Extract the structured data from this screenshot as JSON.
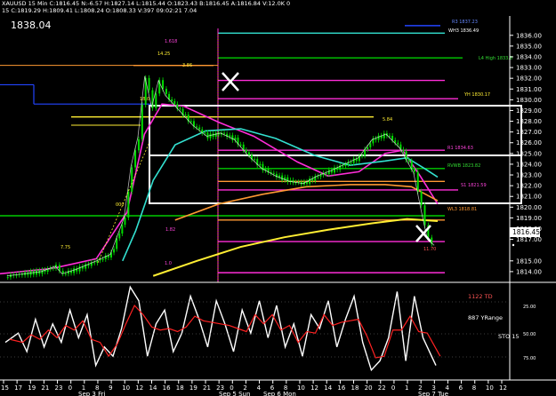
{
  "header": {
    "line1": "XAUUSD 15 Min C:1816.45 N:-6.57 H:1827.14 L:1815.44 O:1823.43 B:1816.45 A:1816.84 V:12.0K 0",
    "line2": "15 C:1819.29 H:1809.41 L:1808.24 O:1808.33 V:397 09:02:21 7.04"
  },
  "price_label": "1838.04",
  "current_price": "1816.45",
  "colors": {
    "background": "#000000",
    "candle": "#00dd00",
    "price_line": "#ffffff",
    "ma_magenta": "#ff2dd8",
    "ma_cyan": "#33e0d0",
    "ma_orange": "#ff9933",
    "ma_yellow": "#ffee33",
    "green_level": "#00cc00",
    "blue_level": "#2244ff",
    "td_red": "#ff2222",
    "stoch_white": "#ffffff",
    "box": "#ffffff"
  },
  "level_labels": {
    "r3": "R3 1837.23",
    "wh3": "WH3 1836.49",
    "l4high": "L4 High 1833.8",
    "yh": "YH 1830.17",
    "r1": "R1 1834.63",
    "mm": "MM 1826.53",
    "rvwb": "RVWB 1823.82",
    "s1": "S1 1821.59",
    "wl3": "WL3 1818.81",
    "m1": "1.618",
    "m2": "1.0",
    "m3": "1.82",
    "m4": "11.70",
    "k1425": "14.25",
    "k386": "3.86",
    "k584": "5.84",
    "k775": "7.75",
    "k18": "18.0",
    "k000": "000"
  },
  "price_ticks": [
    "1836.00",
    "1835.00",
    "1834.00",
    "1833.00",
    "1832.00",
    "1831.00",
    "1830.00",
    "1829.00",
    "1828.00",
    "1827.00",
    "1826.00",
    "1825.00",
    "1824.00",
    "1823.00",
    "1822.00",
    "1821.00",
    "1820.00",
    "1819.00",
    "1818.00",
    "1817.00",
    "1815.00",
    "1814.00"
  ],
  "time_ticks": [
    "15",
    "17",
    "19",
    "21",
    "23",
    "0",
    "1",
    "8",
    "9",
    "10",
    "12",
    "14",
    "16",
    "18",
    "19",
    "21",
    "23",
    "0",
    "2",
    "4",
    "6",
    "8",
    "10",
    "12",
    "14",
    "16",
    "18",
    "20",
    "22",
    "0",
    "1",
    "2",
    "3",
    "4",
    "6",
    "8",
    "10",
    "12"
  ],
  "date_labels": [
    "Sep 3 Fri",
    "Sep 5 Sun",
    "Sep 6 Mon",
    "Sep 7 Tue"
  ],
  "indicator": {
    "td_label": "1122 TD",
    "yrange_label": "887 YRange",
    "sto_label": "STO 15",
    "axis_ticks": [
      "25.00",
      "50.00",
      "75.00"
    ]
  },
  "chart_data": {
    "type": "candlestick",
    "instrument": "XAUUSD",
    "timeframe": "15 Min",
    "title": "",
    "xlabel": "",
    "ylabel": "",
    "ylim": [
      1813.0,
      1837.8
    ],
    "x_range": [
      "Sep 3 14:00",
      "Sep 7 03:00"
    ],
    "grid": false,
    "price_path": [
      [
        "Sep 3 15:00",
        1813.6
      ],
      [
        "Sep 3 20:00",
        1814.0
      ],
      [
        "Sep 3 22:00",
        1814.5
      ],
      [
        "Sep 3 23:00",
        1813.8
      ],
      [
        "Sep 5 23:00",
        1814.2
      ],
      [
        "Sep 6 02:00",
        1815.0
      ],
      [
        "Sep 6 04:00",
        1815.6
      ],
      [
        "Sep 6 06:00",
        1819.0
      ],
      [
        "Sep 6 07:00",
        1823.8
      ],
      [
        "Sep 6 08:00",
        1826.5
      ],
      [
        "Sep 6 09:00",
        1832.2
      ],
      [
        "Sep 6 10:00",
        1829.3
      ],
      [
        "Sep 6 11:00",
        1831.8
      ],
      [
        "Sep 6 12:00",
        1830.4
      ],
      [
        "Sep 6 14:00",
        1829.0
      ],
      [
        "Sep 6 16:00",
        1827.6
      ],
      [
        "Sep 6 18:00",
        1826.6
      ],
      [
        "Sep 6 20:00",
        1826.9
      ],
      [
        "Sep 6 22:00",
        1826.3
      ],
      [
        "Sep 7 00:00",
        1824.8
      ],
      [
        "Sep 7 02:00",
        1823.6
      ],
      [
        "Sep 7 04:00",
        1822.9
      ],
      [
        "Sep 7 06:00",
        1822.4
      ],
      [
        "Sep 7 08:00",
        1822.2
      ],
      [
        "Sep 7 10:00",
        1822.9
      ],
      [
        "Sep 7 12:00",
        1823.4
      ],
      [
        "Sep 7 14:00",
        1824.0
      ],
      [
        "Sep 7 16:00",
        1824.6
      ],
      [
        "Sep 7 18:00",
        1826.3
      ],
      [
        "Sep 7 20:00",
        1826.8
      ],
      [
        "Sep 7 22:00",
        1825.5
      ],
      [
        "Sep 8 00:00",
        1823.2
      ],
      [
        "Sep 8 01:00",
        1820.0
      ],
      [
        "Sep 8 02:00",
        1817.0
      ],
      [
        "Sep 8 03:00",
        1816.45
      ]
    ],
    "series": [
      {
        "name": "ma_magenta",
        "values": [
          [
            0.0,
            1813.8
          ],
          [
            0.12,
            1814.3
          ],
          [
            0.22,
            1815.2
          ],
          [
            0.29,
            1819.5
          ],
          [
            0.33,
            1826.8
          ],
          [
            0.37,
            1829.6
          ],
          [
            0.42,
            1829.4
          ],
          [
            0.5,
            1827.9
          ],
          [
            0.58,
            1826.6
          ],
          [
            0.68,
            1824.2
          ],
          [
            0.75,
            1822.9
          ],
          [
            0.82,
            1823.3
          ],
          [
            0.88,
            1825.0
          ],
          [
            0.92,
            1825.3
          ],
          [
            0.96,
            1822.9
          ],
          [
            1.0,
            1820.3
          ]
        ]
      },
      {
        "name": "ma_cyan",
        "values": [
          [
            0.28,
            1815.0
          ],
          [
            0.31,
            1817.8
          ],
          [
            0.35,
            1822.5
          ],
          [
            0.4,
            1825.8
          ],
          [
            0.47,
            1827.1
          ],
          [
            0.55,
            1827.3
          ],
          [
            0.63,
            1826.4
          ],
          [
            0.72,
            1824.8
          ],
          [
            0.8,
            1823.9
          ],
          [
            0.88,
            1824.3
          ],
          [
            0.93,
            1824.6
          ],
          [
            0.97,
            1823.6
          ],
          [
            1.0,
            1822.8
          ]
        ]
      },
      {
        "name": "ma_orange",
        "values": [
          [
            0.4,
            1818.8
          ],
          [
            0.5,
            1820.3
          ],
          [
            0.6,
            1821.2
          ],
          [
            0.7,
            1821.9
          ],
          [
            0.8,
            1822.1
          ],
          [
            0.88,
            1822.1
          ],
          [
            0.94,
            1821.9
          ],
          [
            1.0,
            1820.6
          ]
        ]
      },
      {
        "name": "ma_yellow",
        "values": [
          [
            0.35,
            1813.6
          ],
          [
            0.45,
            1815.0
          ],
          [
            0.55,
            1816.3
          ],
          [
            0.65,
            1817.2
          ],
          [
            0.75,
            1817.9
          ],
          [
            0.85,
            1818.5
          ],
          [
            0.93,
            1818.9
          ],
          [
            1.0,
            1818.7
          ]
        ]
      }
    ],
    "levels": [
      {
        "value": 1836.9,
        "color": "blue"
      },
      {
        "value": 1836.2,
        "color": "cyan"
      },
      {
        "value": 1833.9,
        "color": "green"
      },
      {
        "value": 1833.2,
        "color": "orange"
      },
      {
        "value": 1831.8,
        "color": "magenta"
      },
      {
        "value": 1830.1,
        "color": "magenta"
      },
      {
        "value": 1828.4,
        "color": "yellow"
      },
      {
        "value": 1825.3,
        "color": "magenta"
      },
      {
        "value": 1823.6,
        "color": "green"
      },
      {
        "value": 1822.4,
        "color": "orange"
      },
      {
        "value": 1821.6,
        "color": "magenta"
      },
      {
        "value": 1819.2,
        "color": "green"
      },
      {
        "value": 1818.8,
        "color": "orange"
      },
      {
        "value": 1816.8,
        "color": "magenta"
      },
      {
        "value": 1813.9,
        "color": "magenta"
      }
    ],
    "stochastic": [
      [
        0.0,
        0.35
      ],
      [
        0.03,
        0.45
      ],
      [
        0.05,
        0.25
      ],
      [
        0.07,
        0.6
      ],
      [
        0.09,
        0.3
      ],
      [
        0.11,
        0.55
      ],
      [
        0.13,
        0.35
      ],
      [
        0.15,
        0.7
      ],
      [
        0.17,
        0.4
      ],
      [
        0.19,
        0.65
      ],
      [
        0.21,
        0.1
      ],
      [
        0.23,
        0.3
      ],
      [
        0.25,
        0.2
      ],
      [
        0.27,
        0.5
      ],
      [
        0.29,
        0.95
      ],
      [
        0.31,
        0.8
      ],
      [
        0.33,
        0.2
      ],
      [
        0.35,
        0.55
      ],
      [
        0.37,
        0.7
      ],
      [
        0.39,
        0.25
      ],
      [
        0.41,
        0.45
      ],
      [
        0.43,
        0.85
      ],
      [
        0.45,
        0.6
      ],
      [
        0.47,
        0.3
      ],
      [
        0.49,
        0.8
      ],
      [
        0.51,
        0.55
      ],
      [
        0.53,
        0.25
      ],
      [
        0.55,
        0.7
      ],
      [
        0.57,
        0.45
      ],
      [
        0.59,
        0.8
      ],
      [
        0.61,
        0.4
      ],
      [
        0.63,
        0.75
      ],
      [
        0.65,
        0.3
      ],
      [
        0.67,
        0.55
      ],
      [
        0.69,
        0.2
      ],
      [
        0.71,
        0.65
      ],
      [
        0.73,
        0.5
      ],
      [
        0.75,
        0.8
      ],
      [
        0.77,
        0.3
      ],
      [
        0.79,
        0.6
      ],
      [
        0.81,
        0.85
      ],
      [
        0.83,
        0.35
      ],
      [
        0.85,
        0.05
      ],
      [
        0.87,
        0.15
      ],
      [
        0.89,
        0.4
      ],
      [
        0.91,
        0.9
      ],
      [
        0.93,
        0.15
      ],
      [
        0.95,
        0.85
      ],
      [
        0.97,
        0.4
      ],
      [
        1.0,
        0.1
      ]
    ]
  }
}
